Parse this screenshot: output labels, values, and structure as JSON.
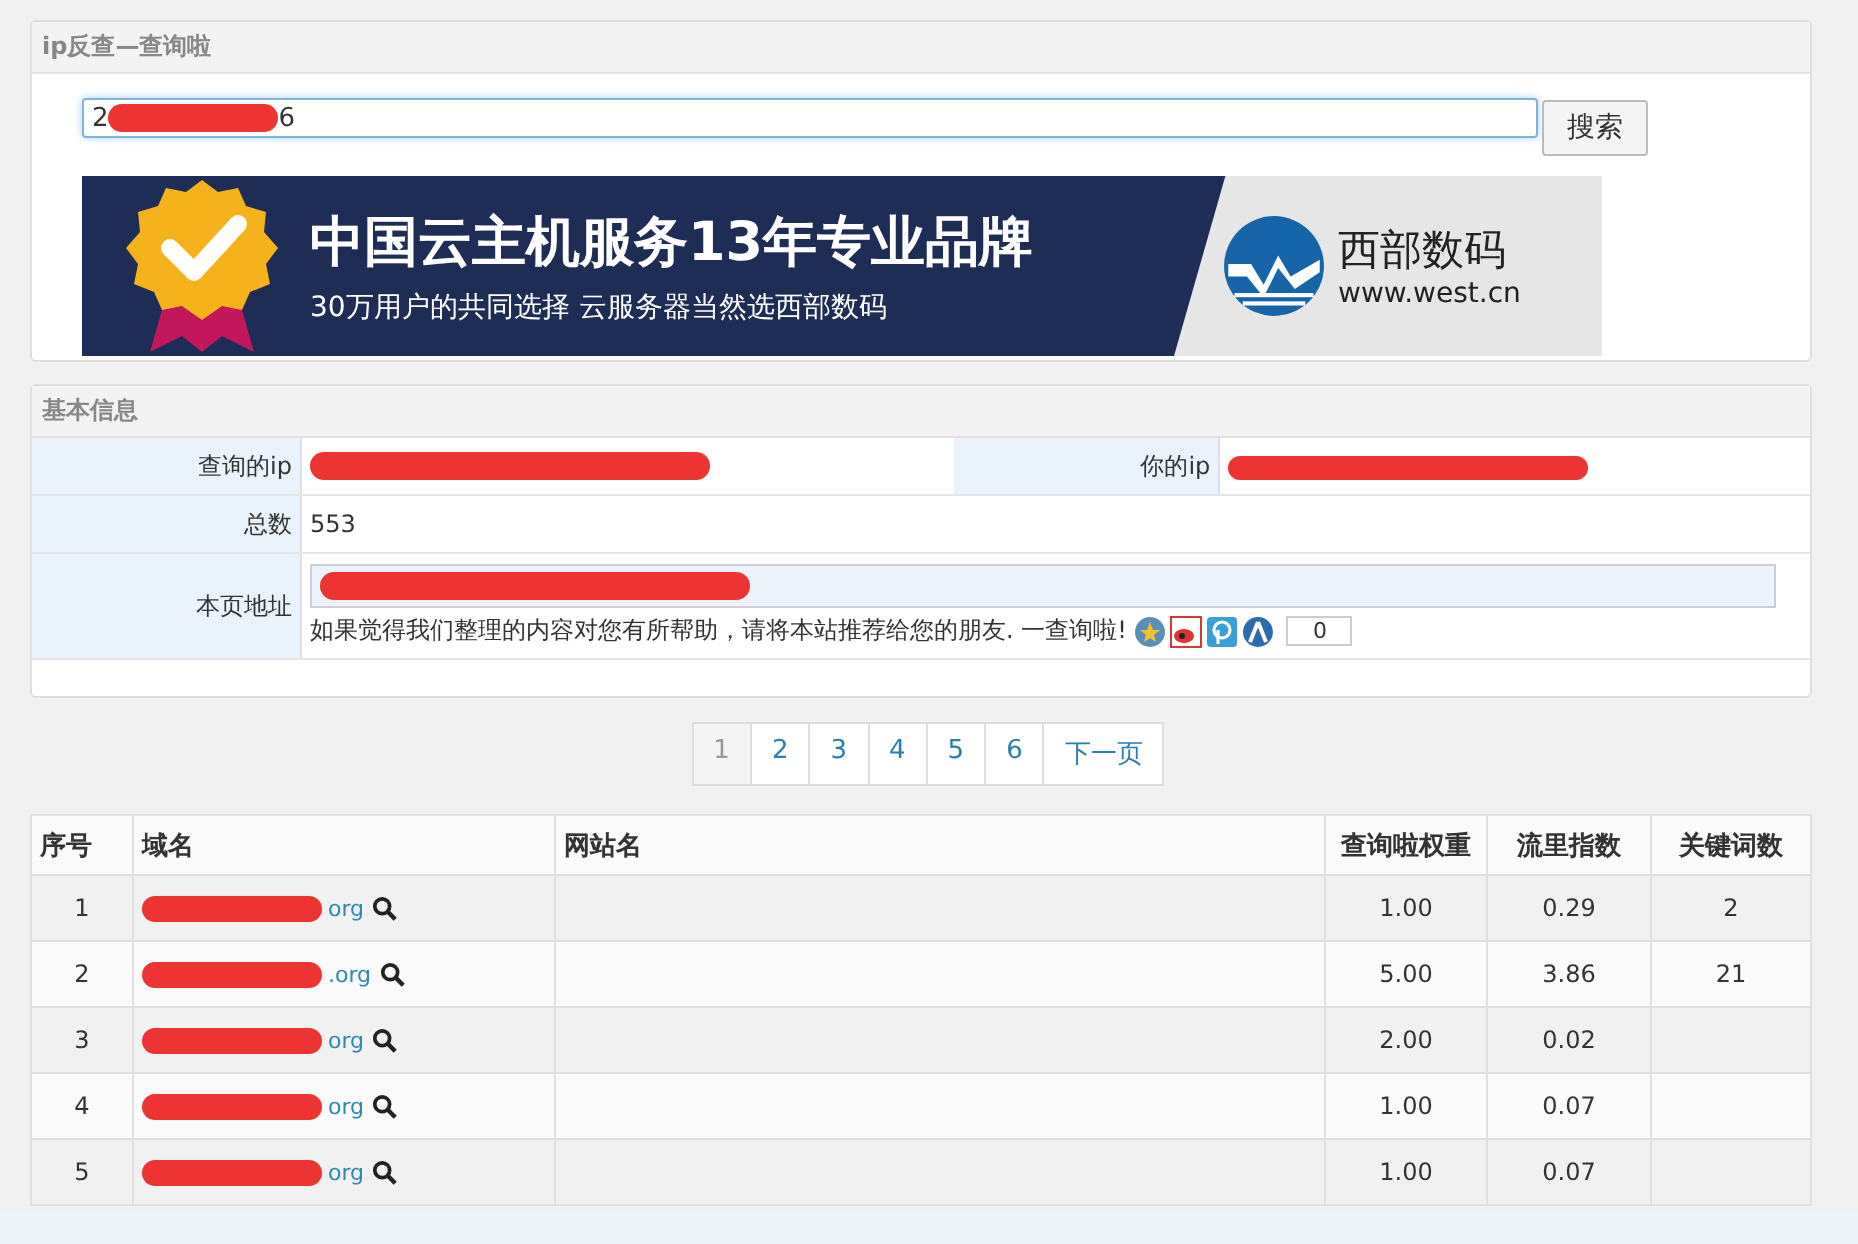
{
  "search_panel": {
    "title": "ip反查—查询啦",
    "query": {
      "before": "2",
      "after": "6",
      "redacted": true
    },
    "button": "搜索"
  },
  "banner": {
    "headline": "中国云主机服务13年专业品牌",
    "tagline": "30万用户的共同选择   云服务器当然选西部数码",
    "brand": "西部数码",
    "url": "www.west.cn"
  },
  "info_panel": {
    "title": "基本信息",
    "rows": [
      {
        "kind": "pair",
        "label": "查询的ip",
        "value_redacted": true,
        "label2": "你的ip",
        "value2_redacted": true
      },
      {
        "kind": "text",
        "label": "总数",
        "value": "553"
      },
      {
        "kind": "link",
        "label": "本页地址",
        "value_redacted": true,
        "note": "如果觉得我们整理的内容对您有所帮助，请将本站推荐给您的朋友. 一查询啦!",
        "share_count": "0"
      }
    ]
  },
  "pagination": [
    {
      "label": "1",
      "selected": true
    },
    {
      "label": "2",
      "selected": false
    },
    {
      "label": "3",
      "selected": false
    },
    {
      "label": "4",
      "selected": false
    },
    {
      "label": "5",
      "selected": false
    },
    {
      "label": "6",
      "selected": false
    },
    {
      "label": "下一页",
      "selected": false
    }
  ],
  "table": {
    "columns": [
      "序号",
      "域名",
      "网站名",
      "查询啦权重",
      "流里指数",
      "关键词数"
    ],
    "rows": [
      {
        "index": "1",
        "domain": "org",
        "weight": "1.00",
        "traffic": "0.29",
        "keywords": "2"
      },
      {
        "index": "2",
        "domain": ".org",
        "weight": "5.00",
        "traffic": "3.86",
        "keywords": "21"
      },
      {
        "index": "3",
        "domain": "org",
        "weight": "2.00",
        "traffic": "0.02"
      },
      {
        "index": "4",
        "domain": "org",
        "weight": "1.00",
        "traffic": "0.07"
      },
      {
        "index": "5",
        "domain": "org",
        "weight": "1.00",
        "traffic": "0.07"
      }
    ]
  }
}
